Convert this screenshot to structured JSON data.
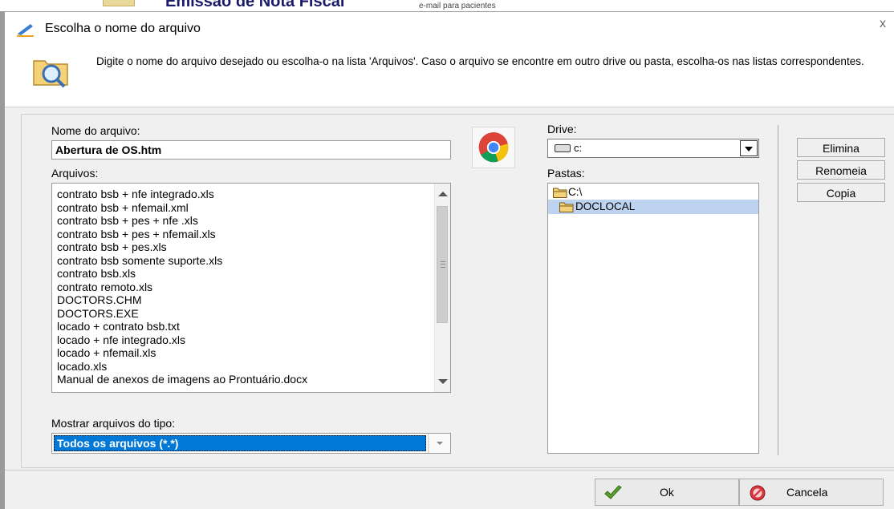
{
  "background_app": {
    "title_fragment": "Emissão de Nota Fiscal",
    "subtitle_fragment": "e-mail para pacientes"
  },
  "dialog": {
    "title": "Escolha o nome do arquivo",
    "close_label": "x",
    "instructions": "Digite o nome do arquivo desejado ou escolha-o na lista 'Arquivos'. Caso o arquivo se encontre em outro drive ou pasta, escolha-os nas listas correspondentes."
  },
  "filename": {
    "label": "Nome do arquivo:",
    "value": "Abertura de OS.htm"
  },
  "files": {
    "label": "Arquivos:",
    "items": [
      "contrato bsb + nfe integrado.xls",
      "contrato bsb + nfemail.xml",
      "contrato bsb + pes + nfe .xls",
      "contrato bsb + pes + nfemail.xls",
      "contrato bsb + pes.xls",
      "contrato bsb somente suporte.xls",
      "contrato bsb.xls",
      "contrato remoto.xls",
      "DOCTORS.CHM",
      "DOCTORS.EXE",
      "locado + contrato bsb.txt",
      "locado + nfe integrado.xls",
      "locado + nfemail.xls",
      "locado.xls",
      "Manual de anexos de imagens ao Prontuário.docx"
    ]
  },
  "file_type": {
    "label": "Mostrar arquivos do tipo:",
    "value": "Todos os arquivos (*.*)"
  },
  "drive": {
    "label": "Drive:",
    "value": "c:"
  },
  "folders": {
    "label": "Pastas:",
    "items": [
      "C:\\",
      "DOCLOCAL"
    ],
    "selected": "DOCLOCAL"
  },
  "side_buttons": {
    "delete": "Elimina",
    "rename": "Renomeia",
    "copy": "Copia"
  },
  "footer": {
    "ok": "Ok",
    "cancel": "Cancela"
  },
  "colors": {
    "selection": "#0078d7",
    "folder_selection": "#bdd3ef",
    "ok_check": "#5aa02c",
    "cancel_icon": "#d9363e"
  },
  "icons": {
    "title": "pencil-icon",
    "header": "folder-search-icon",
    "browser": "chrome-icon",
    "drive": "hard-drive-icon",
    "folder": "folder-icon",
    "ok": "checkmark-icon",
    "cancel": "no-entry-icon"
  }
}
